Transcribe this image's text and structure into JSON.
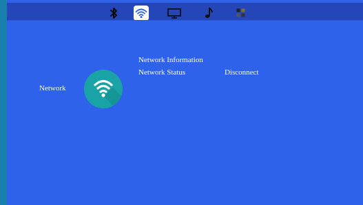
{
  "tabs": [
    {
      "icon": "bluetooth-icon"
    },
    {
      "icon": "wifi-icon",
      "active": true
    },
    {
      "icon": "monitor-icon"
    },
    {
      "icon": "music-note-icon"
    },
    {
      "icon": "apps-grid-icon"
    }
  ],
  "network": {
    "label": "Network",
    "icon": "wifi-icon",
    "icon_color": "#1aa3a6",
    "info_title": "Network Information",
    "status_label": "Network Status",
    "status_value": "Disconnect"
  },
  "colors": {
    "background": "#2e62ea",
    "topbar": "#2446b8",
    "frame": "#1b7fae"
  }
}
